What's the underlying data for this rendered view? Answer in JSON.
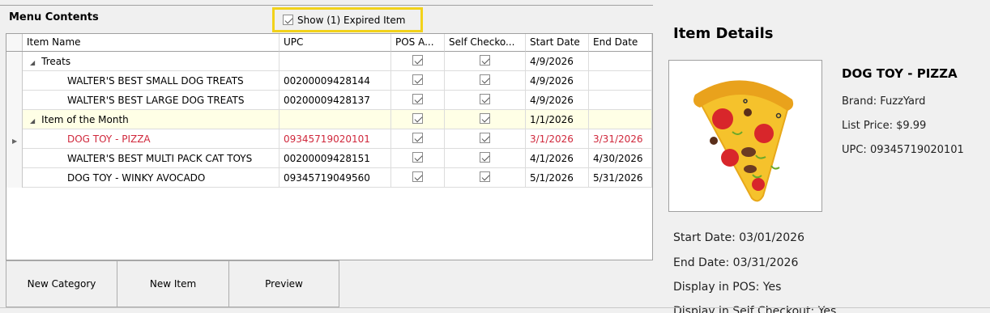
{
  "menu": {
    "title": "Menu Contents",
    "show_expired_label": "Show (1) Expired Item",
    "show_expired_checked": true
  },
  "grid": {
    "columns": [
      "Item Name",
      "UPC",
      "POS A...",
      "Self Checko...",
      "Start Date",
      "End Date"
    ],
    "rows": [
      {
        "type": "category",
        "name": "Treats",
        "upc": "",
        "pos": true,
        "self": true,
        "start": "4/9/2026",
        "end": ""
      },
      {
        "type": "item",
        "name": "WALTER'S BEST SMALL DOG TREATS",
        "upc": "00200009428144",
        "pos": true,
        "self": true,
        "start": "4/9/2026",
        "end": ""
      },
      {
        "type": "item",
        "name": "WALTER'S BEST LARGE DOG TREATS",
        "upc": "00200009428137",
        "pos": true,
        "self": true,
        "start": "4/9/2026",
        "end": ""
      },
      {
        "type": "category",
        "name": "Item of the Month",
        "upc": "",
        "pos": true,
        "self": true,
        "start": "1/1/2026",
        "end": ""
      },
      {
        "type": "item",
        "name": "DOG TOY - PIZZA",
        "upc": "09345719020101",
        "pos": true,
        "self": true,
        "start": "3/1/2026",
        "end": "3/31/2026",
        "expired": true
      },
      {
        "type": "item",
        "name": "WALTER'S BEST MULTI PACK CAT TOYS",
        "upc": "00200009428151",
        "pos": true,
        "self": true,
        "start": "4/1/2026",
        "end": "4/30/2026"
      },
      {
        "type": "item",
        "name": "DOG TOY - WINKY AVOCADO",
        "upc": "09345719049560",
        "pos": true,
        "self": true,
        "start": "5/1/2026",
        "end": "5/31/2026"
      }
    ]
  },
  "buttons": {
    "new_category": "New Category",
    "new_item": "New Item",
    "preview": "Preview"
  },
  "details": {
    "title": "Item Details",
    "product_name": "DOG TOY - PIZZA",
    "brand": "Brand: FuzzYard",
    "list_price": "List Price: $9.99",
    "upc": "UPC: 09345719020101",
    "start_date": "Start Date: 03/01/2026",
    "end_date": "End Date: 03/31/2026",
    "display_pos": "Display in POS: Yes",
    "display_self_checkout": "Display in Self Checkout: Yes"
  },
  "colors": {
    "expired_text": "#d0283c",
    "highlight_box": "#f2d21a",
    "category_row_bg": "#ffffe6"
  }
}
